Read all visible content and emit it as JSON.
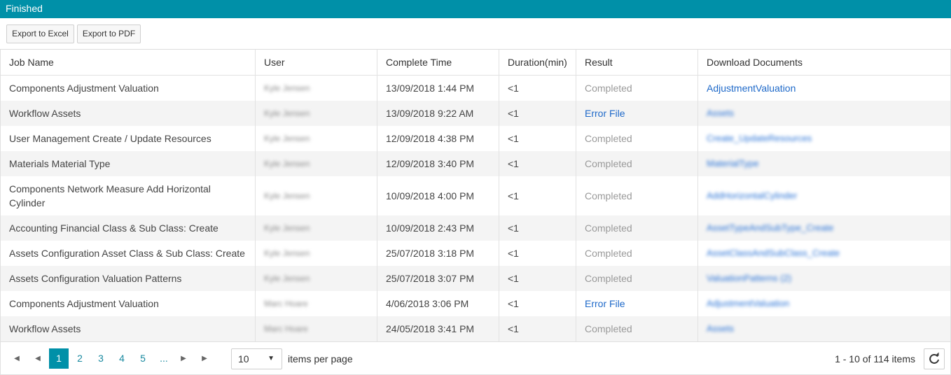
{
  "panel": {
    "title": "Finished"
  },
  "toolbar": {
    "export_excel": "Export to Excel",
    "export_pdf": "Export to PDF"
  },
  "columns": [
    "Job Name",
    "User",
    "Complete Time",
    "Duration(min)",
    "Result",
    "Download Documents"
  ],
  "rows": [
    {
      "job": "Components Adjustment Valuation",
      "user": "Kyle Jensen",
      "time": "13/09/2018 1:44 PM",
      "duration": "<1",
      "result": "Completed",
      "doc": "AdjustmentValuation"
    },
    {
      "job": "Workflow Assets",
      "user": "Kyle Jensen",
      "time": "13/09/2018 9:22 AM",
      "duration": "<1",
      "result": "Error File",
      "doc": "Assets"
    },
    {
      "job": "User Management Create / Update Resources",
      "user": "Kyle Jensen",
      "time": "12/09/2018 4:38 PM",
      "duration": "<1",
      "result": "Completed",
      "doc": "Create_UpdateResources"
    },
    {
      "job": "Materials Material Type",
      "user": "Kyle Jensen",
      "time": "12/09/2018 3:40 PM",
      "duration": "<1",
      "result": "Completed",
      "doc": "MaterialType"
    },
    {
      "job": "Components Network Measure Add Horizontal Cylinder",
      "user": "Kyle Jensen",
      "time": "10/09/2018 4:00 PM",
      "duration": "<1",
      "result": "Completed",
      "doc": "AddHorizontalCylinder"
    },
    {
      "job": "Accounting Financial Class & Sub Class: Create",
      "user": "Kyle Jensen",
      "time": "10/09/2018 2:43 PM",
      "duration": "<1",
      "result": "Completed",
      "doc": "AssetTypeAndSubType_Create"
    },
    {
      "job": "Assets Configuration Asset Class & Sub Class: Create",
      "user": "Kyle Jensen",
      "time": "25/07/2018 3:18 PM",
      "duration": "<1",
      "result": "Completed",
      "doc": "AssetClassAndSubClass_Create"
    },
    {
      "job": "Assets Configuration Valuation Patterns",
      "user": "Kyle Jensen",
      "time": "25/07/2018 3:07 PM",
      "duration": "<1",
      "result": "Completed",
      "doc": "ValuationPatterns (2)"
    },
    {
      "job": "Components Adjustment Valuation",
      "user": "Marc Hoare",
      "time": "4/06/2018 3:06 PM",
      "duration": "<1",
      "result": "Error File",
      "doc": "AdjustmentValuation"
    },
    {
      "job": "Workflow Assets",
      "user": "Marc Hoare",
      "time": "24/05/2018 3:41 PM",
      "duration": "<1",
      "result": "Completed",
      "doc": "Assets"
    }
  ],
  "pager": {
    "pages": [
      "1",
      "2",
      "3",
      "4",
      "5",
      "..."
    ],
    "current": 1,
    "page_size": "10",
    "items_per_page_label": "items per page",
    "info": "1 - 10 of 114 items"
  },
  "colors": {
    "accent": "#0090a8",
    "link": "#1e69c9",
    "muted": "#9a9a9a"
  }
}
